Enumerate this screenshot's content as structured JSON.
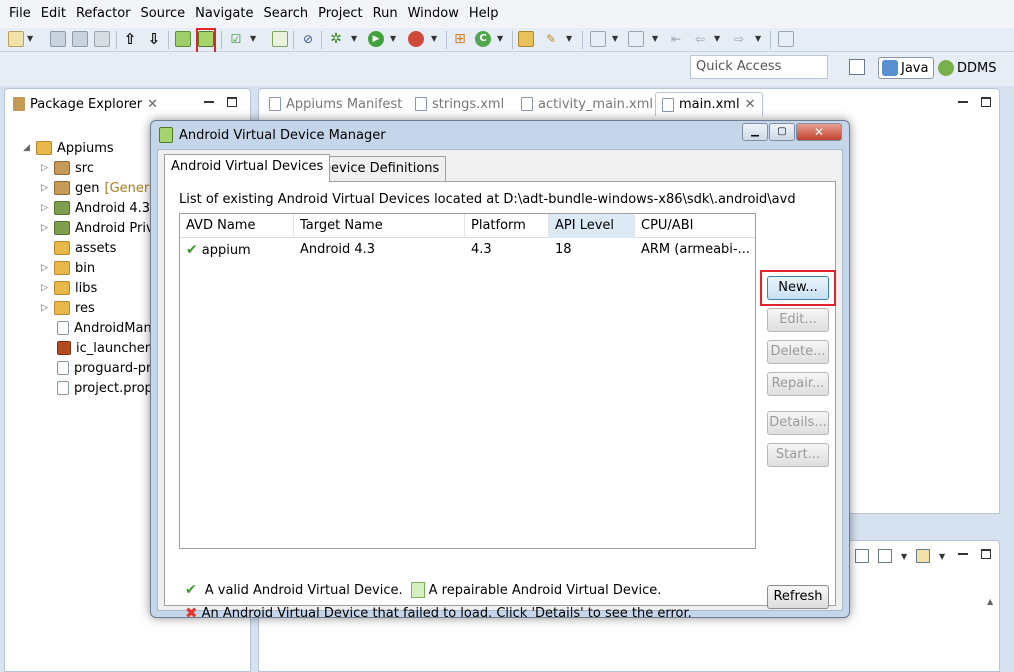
{
  "menu": [
    "File",
    "Edit",
    "Refactor",
    "Source",
    "Navigate",
    "Search",
    "Project",
    "Run",
    "Window",
    "Help"
  ],
  "quick_access": {
    "placeholder": "Quick Access"
  },
  "perspectives": {
    "java": "Java",
    "ddms": "DDMS"
  },
  "package_explorer": {
    "title": "Package Explorer",
    "project": "Appiums",
    "items": [
      {
        "label": "src",
        "kind": "pkg"
      },
      {
        "label": "gen",
        "extra": "[Genera",
        "kind": "pkg"
      },
      {
        "label": "Android 4.3",
        "kind": "lib"
      },
      {
        "label": "Android Priva",
        "kind": "lib"
      },
      {
        "label": "assets",
        "kind": "folder"
      },
      {
        "label": "bin",
        "kind": "folder"
      },
      {
        "label": "libs",
        "kind": "folder"
      },
      {
        "label": "res",
        "kind": "folder"
      },
      {
        "label": "AndroidMan",
        "kind": "file"
      },
      {
        "label": "ic_launcher-w",
        "kind": "image"
      },
      {
        "label": "proguard-pr",
        "kind": "file"
      },
      {
        "label": "project.prop",
        "kind": "file"
      }
    ]
  },
  "editor_tabs": [
    "Appiums Manifest",
    "strings.xml",
    "activity_main.xml",
    "main.xml"
  ],
  "dialog": {
    "title": "Android Virtual Device Manager",
    "tabs": [
      "Android Virtual Devices",
      "Device Definitions"
    ],
    "description": "List of existing Android Virtual Devices located at D:\\adt-bundle-windows-x86\\sdk\\.android\\avd",
    "columns": [
      "AVD Name",
      "Target Name",
      "Platform",
      "API Level",
      "CPU/ABI"
    ],
    "rows": [
      {
        "name": "appium",
        "target": "Android 4.3",
        "platform": "4.3",
        "api": "18",
        "cpu": "ARM (armeabi-..."
      }
    ],
    "buttons": {
      "new": "New...",
      "edit": "Edit...",
      "delete": "Delete...",
      "repair": "Repair...",
      "details": "Details...",
      "start": "Start...",
      "refresh": "Refresh"
    },
    "legend": {
      "valid": "A valid Android Virtual Device.",
      "repairable": "A repairable Android Virtual Device.",
      "failed": "An Android Virtual Device that failed to load. Click 'Details' to see the error."
    }
  }
}
